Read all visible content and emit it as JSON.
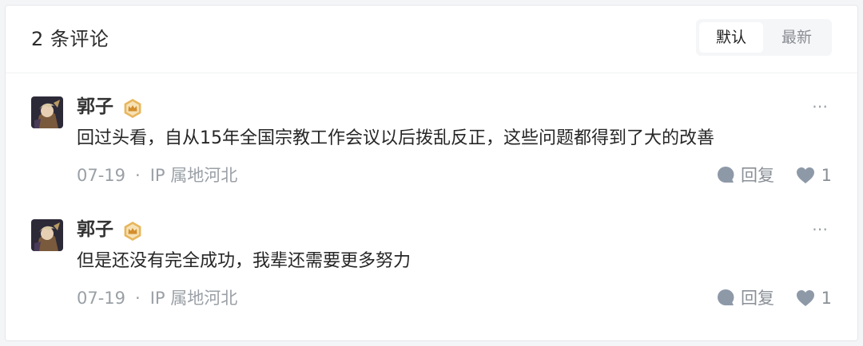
{
  "header": {
    "comment_count": "2 条评论",
    "sort_options": [
      {
        "label": "默认",
        "active": true
      },
      {
        "label": "最新",
        "active": false
      }
    ]
  },
  "comments": [
    {
      "author": "郭子",
      "badge_icon": "crown-badge-icon",
      "content": "回过头看，自从15年全国宗教工作会议以后拨乱反正，这些问题都得到了大的改善",
      "date": "07-19",
      "separator": "·",
      "location": "IP 属地河北",
      "reply_label": "回复",
      "like_count": "1"
    },
    {
      "author": "郭子",
      "badge_icon": "crown-badge-icon",
      "content": "但是还没有完全成功，我辈还需要更多努力",
      "date": "07-19",
      "separator": "·",
      "location": "IP 属地河北",
      "reply_label": "回复",
      "like_count": "1"
    }
  ],
  "colors": {
    "badge_gold": "#e0a94a",
    "icon_gray": "#8e99a8",
    "text_muted": "#9aa0a6"
  }
}
